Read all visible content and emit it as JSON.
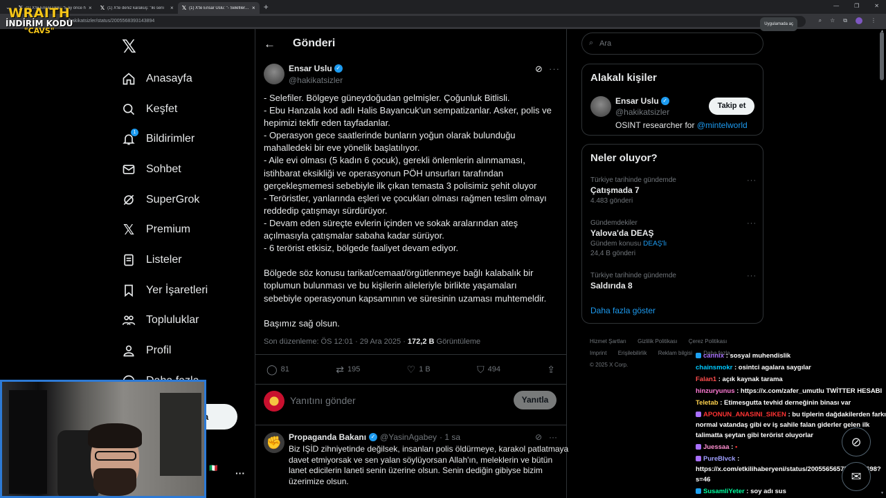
{
  "browser": {
    "tabs": [
      {
        "title": "(1) X'te Ensar Uslu: \"5 ay önce h",
        "active": false
      },
      {
        "title": "(1) X'te deniz karakuş: \"iki senı",
        "active": false
      },
      {
        "title": "(1) X'te Ensar Uslu: \"- Selefiler. B",
        "active": true
      }
    ],
    "url_domain": "",
    "url_path": "/hakikatsizler/status/2005568393143894",
    "open_app_label": "Uygulamada aç"
  },
  "overlay_logo": {
    "line1": "WRAITH",
    "line2": "İNDİRİM KODU",
    "line3": "\"CAVS\""
  },
  "nav": {
    "items": [
      {
        "label": "Anasayfa",
        "icon": "home-icon"
      },
      {
        "label": "Keşfet",
        "icon": "search-icon"
      },
      {
        "label": "Bildirimler",
        "icon": "bell-icon",
        "badge": "1"
      },
      {
        "label": "Sohbet",
        "icon": "mail-icon"
      },
      {
        "label": "SuperGrok",
        "icon": "grok-icon"
      },
      {
        "label": "Premium",
        "icon": "x-icon"
      },
      {
        "label": "Listeler",
        "icon": "list-icon"
      },
      {
        "label": "Yer İşaretleri",
        "icon": "bookmark-icon"
      },
      {
        "label": "Topluluklar",
        "icon": "people-icon"
      },
      {
        "label": "Profil",
        "icon": "person-icon"
      },
      {
        "label": "Daha fazla",
        "icon": "more-circle-icon"
      }
    ],
    "post_button_partial": "a"
  },
  "main": {
    "title": "Gönderi",
    "tweet": {
      "author_name": "Ensar Uslu",
      "author_handle": "@hakikatsizler",
      "lines": [
        "- Selefiler. Bölgeye güneydoğudan gelmişler. Çoğunluk Bitlisli.",
        "- Ebu Hanzala kod adlı Halis Bayancuk'un sempatizanlar. Asker, polis ve",
        "hepimizi tekfir eden tayfadanlar.",
        "- Operasyon gece saatlerinde bunların yoğun olarak bulunduğu",
        "mahalledeki bir eve yönelik başlatılıyor.",
        "- Aile evi olması (5 kadın 6 çocuk), gerekli önlemlerin alınmaması,",
        "istihbarat eksikliği ve operasyonun PÖH unsurları tarafından",
        "gerçekleşmemesi sebebiyle ilk çıkan temasta 3 polisimiz şehit oluyor",
        "- Teröristler, yanlarında eşleri ve çocukları olması rağmen teslim olmayı",
        "reddedip çatışmayı sürdürüyor.",
        "- Devam eden süreçte evlerin içinden ve sokak aralarından ateş",
        "açılmasıyla çatışmalar sabaha kadar sürüyor.",
        "- 6 terörist etkisiz, bölgede faaliyet devam ediyor.",
        "",
        "Bölgede söz konusu tarikat/cemaat/örgütlenmeye bağlı kalabalık bir",
        "toplumun bulunması ve bu kişilerin aileleriyle birlikte yaşamaları",
        "sebebiyle operasyonun kapsamının ve süresinin uzaması muhtemeldir.",
        "",
        "Başımız sağ olsun."
      ],
      "meta_prefix": "Son düzenleme: ÖS 12:01 · 29 Ara 2025 · ",
      "views": "172,2 B",
      "views_suffix": " Görüntüleme",
      "replies": "81",
      "retweets": "195",
      "likes": "1 B",
      "bookmarks": "494"
    },
    "reply_placeholder": "Yanıtını gönder",
    "reply_button": "Yanıtla",
    "reply": {
      "name": "Propaganda Bakanı",
      "handle": "@YasinAgabey",
      "time": "· 1 sa",
      "lines": [
        "Biz IŞİD zihniyetinde değilsek, insanları polis öldürmeye, karakol patlatmaya",
        "davet etmiyorsak ve sen yalan söylüyorsan Allah'ın, meleklerin ve bütün",
        "lanet edicilerin laneti senin üzerine olsun. Senin dediğin gibiyse bizim",
        "üzerimize olsun."
      ]
    }
  },
  "right": {
    "search_placeholder": "Ara",
    "related_title": "Alakalı kişiler",
    "related": {
      "name": "Ensar Uslu",
      "handle": "@hakikatsizler",
      "bio": "OSINT researcher for ",
      "bio_mention": "@mintelworld",
      "follow": "Takip et"
    },
    "trends_title": "Neler oluyor?",
    "trends": [
      {
        "context": "Türkiye tarihinde gündemde",
        "title": "Çatışmada 7",
        "count": "4.483 gönderi"
      },
      {
        "context": "Gündemdekiler",
        "title": "Yalova'da DEAŞ",
        "topic_prefix": "Gündem konusu ",
        "topic_link": "DEAŞ'lı",
        "count": "24,4 B gönderi"
      },
      {
        "context": "Türkiye tarihinde gündemde",
        "title": "Saldırıda 8"
      }
    ],
    "show_more": "Daha fazla göster",
    "footer": [
      "Hizmet Şartları",
      "Gizlilik Politikası",
      "Çerez Politikası",
      "Imprint",
      "Erişilebilirlik",
      "Reklam bilgisi",
      "Daha fazla ...",
      "© 2025 X Corp."
    ]
  },
  "chat": [
    {
      "user": "cannix",
      "color": "#a970ff",
      "text": " : sosyal muhendislik",
      "badge": "#1da1f2"
    },
    {
      "user": "chainsmokr",
      "color": "#00c8ff",
      "text": " : osintci agalara saygılar"
    },
    {
      "user": "Falan1",
      "color": "#ff4d4d",
      "text": " : açık kaynak tarama"
    },
    {
      "user": "hinzuryunus",
      "color": "#ff7bd5",
      "text": " : https://x.com/zafer_umutlu TWİTTER HESABI"
    },
    {
      "user": "Teletab",
      "color": "#ffd24d",
      "text": " : Etimesgutta tevhid derneğinin binası var"
    },
    {
      "user": "APONUN_ANASINI_SIKEN",
      "color": "#ff3333",
      "text": " : bu tiplerin dağdakilerden farkı normal vatandaş gibi ev iş sahile falan giderler gelen ilk talimatta şeytan gibi terörist oluyorlar",
      "badge": "#a970ff"
    },
    {
      "user": "Juessaa",
      "color": "#ff8fd1",
      "text": " : ",
      "badge": "#a970ff"
    },
    {
      "user": "PureBlvck",
      "color": "#a0a0ff",
      "text": " : https://x.com/etkilihaberyeni/status/2005565657520354698?s=46",
      "badge": "#a970ff"
    },
    {
      "user": "SusamliYeter",
      "color": "#00ffa0",
      "text": " : soy adı sus",
      "badge": "#1da1f2"
    }
  ]
}
